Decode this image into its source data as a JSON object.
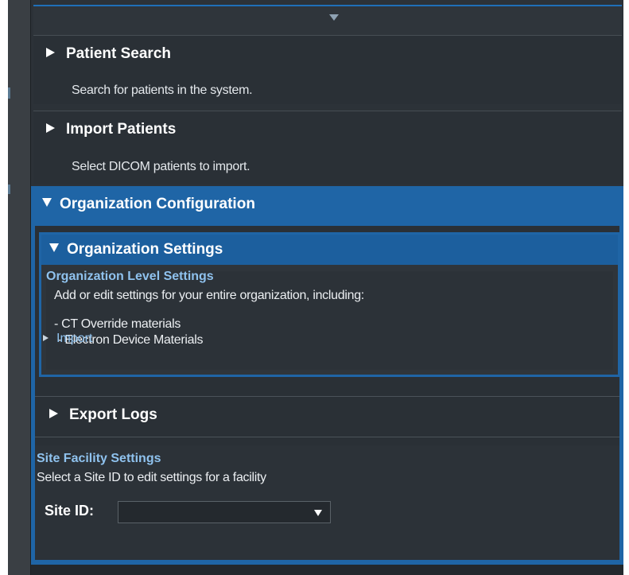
{
  "panel": {
    "collapse_indicator": "chevron-down-icon"
  },
  "items": [
    {
      "title": "Patient Search",
      "description": "Search for patients in the system."
    },
    {
      "title": "Import Patients",
      "description": "Select DICOM patients to import."
    }
  ],
  "org_config": {
    "title": "Organization Configuration",
    "settings": {
      "title": "Organization Settings",
      "level_heading": "Organization Level Settings",
      "description": "Add or edit settings for your entire organization, including:",
      "bullets": [
        "- CT Override materials",
        " - Electron Device Materials"
      ],
      "import_label": "Import"
    },
    "export_logs": "Export Logs",
    "site": {
      "heading": "Site Facility Settings",
      "description": "Select a Site ID to edit settings for a facility",
      "label": "Site ID:",
      "selected": ""
    }
  },
  "colors": {
    "accent": "#1f65a6",
    "link": "#8fc2ee",
    "panel_bg": "#2c3238"
  }
}
